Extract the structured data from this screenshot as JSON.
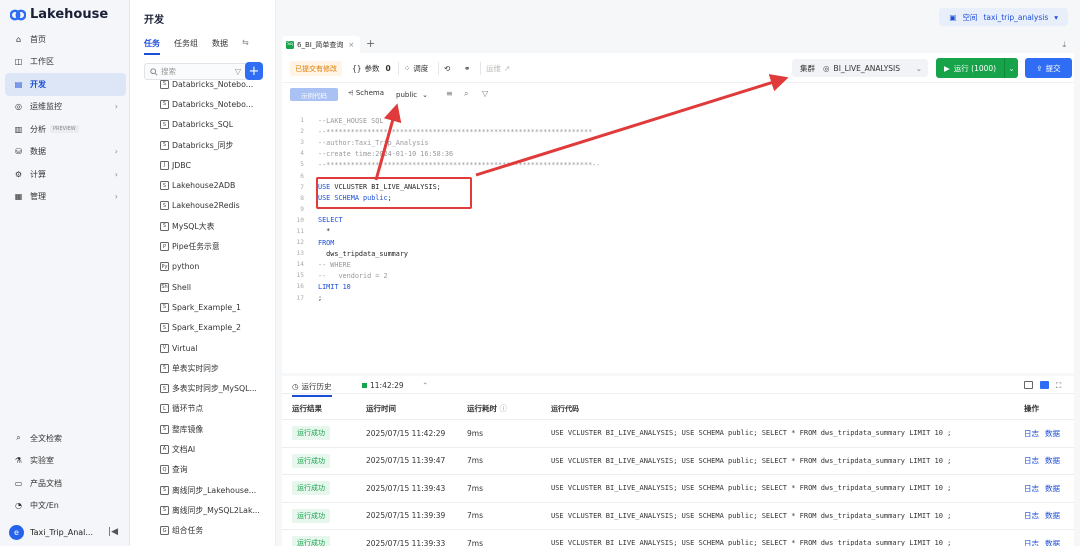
{
  "brand": {
    "name": "Lakehouse",
    "color": "#2f6df5"
  },
  "nav": {
    "items": [
      {
        "label": "首页",
        "icon": "home-icon"
      },
      {
        "label": "工作区",
        "icon": "cube-icon"
      },
      {
        "label": "开发",
        "icon": "code-icon",
        "active": true
      },
      {
        "label": "运维监控",
        "icon": "monitor-icon",
        "arrow": "›"
      },
      {
        "label": "分析",
        "icon": "chart-icon",
        "badge": "PREVIEW"
      },
      {
        "label": "数据",
        "icon": "database-icon",
        "arrow": "›"
      },
      {
        "label": "计算",
        "icon": "compute-icon",
        "arrow": "›"
      },
      {
        "label": "管理",
        "icon": "settings-icon",
        "arrow": "›"
      }
    ],
    "bottom": [
      {
        "label": "全文检索",
        "icon": "search-icon"
      },
      {
        "label": "实验室",
        "icon": "lab-icon"
      },
      {
        "label": "产品文档",
        "icon": "doc-icon"
      },
      {
        "label": "中文/En",
        "icon": "language-icon"
      }
    ],
    "user": {
      "name": "Taxi_Trip_Anal...",
      "initial": "e"
    }
  },
  "tasks_panel": {
    "title": "开发",
    "tabs": [
      "任务",
      "任务组",
      "数据"
    ],
    "search_placeholder": "搜索",
    "items": [
      {
        "label": "Databricks_Notebo...",
        "icon": "S"
      },
      {
        "label": "Databricks_Notebo...",
        "icon": "S"
      },
      {
        "label": "Databricks_SQL",
        "icon": "S"
      },
      {
        "label": "Databricks_同步",
        "icon": "S"
      },
      {
        "label": "JDBC",
        "icon": "J"
      },
      {
        "label": "Lakehouse2ADB",
        "icon": "S"
      },
      {
        "label": "Lakehouse2Redis",
        "icon": "S"
      },
      {
        "label": "MySQL大表",
        "icon": "S"
      },
      {
        "label": "Pipe任务示意",
        "icon": "P"
      },
      {
        "label": "python",
        "icon": "Py"
      },
      {
        "label": "Shell",
        "icon": "Sh"
      },
      {
        "label": "Spark_Example_1",
        "icon": "S"
      },
      {
        "label": "Spark_Example_2",
        "icon": "S"
      },
      {
        "label": "Virtual",
        "icon": "V"
      },
      {
        "label": "单表实时同步",
        "icon": "S"
      },
      {
        "label": "多表实时同步_MySQL...",
        "icon": "S"
      },
      {
        "label": "循环节点",
        "icon": "L"
      },
      {
        "label": "整库镜像",
        "icon": "S"
      },
      {
        "label": "文档AI",
        "icon": "A"
      },
      {
        "label": "查询",
        "icon": "Q"
      },
      {
        "label": "离线同步_Lakehouse...",
        "icon": "S"
      },
      {
        "label": "离线同步_MySQL2Lak...",
        "icon": "S"
      },
      {
        "label": "组合任务",
        "icon": "G"
      }
    ]
  },
  "header": {
    "space_label": "空间",
    "space_value": "taxi_trip_analysis"
  },
  "file_tab": {
    "label": "6_BI_简单查询",
    "icon": "Sq"
  },
  "toolbar": {
    "unsaved": "已提交有修改",
    "params": "参数",
    "params_count": "0",
    "schedule": "调度",
    "deploy": "运维",
    "cluster_label": "集群",
    "cluster_value": "BI_LIVE_ANALYSIS",
    "run_label": "运行 (1000)",
    "submit_label": "提交"
  },
  "subtoolbar": {
    "format": "示例代码",
    "schema_label": "Schema",
    "schema_value": "public"
  },
  "code_lines": [
    [
      {
        "t": "--LAKE_HOUSE SQL",
        "c": "cm"
      }
    ],
    [
      {
        "t": "--*****************************************************************",
        "c": "cm"
      }
    ],
    [
      {
        "t": "--author:Taxi_Trip_Analysis",
        "c": "cm"
      }
    ],
    [
      {
        "t": "--create time:2024-01-10 16:58:36",
        "c": "cm"
      }
    ],
    [
      {
        "t": "--*****************************************************************--",
        "c": "cm"
      }
    ],
    [],
    [
      {
        "t": "USE ",
        "c": "kw"
      },
      {
        "t": "VCLUSTER BI_LIVE_ANALYSIS;",
        "c": "tx"
      }
    ],
    [
      {
        "t": "USE ",
        "c": "kw"
      },
      {
        "t": "SCHEMA ",
        "c": "kw"
      },
      {
        "t": "public",
        "c": "kw"
      },
      {
        "t": ";",
        "c": "tx"
      }
    ],
    [],
    [
      {
        "t": "SELECT",
        "c": "kw"
      }
    ],
    [
      {
        "t": "  *",
        "c": "tx"
      }
    ],
    [
      {
        "t": "FROM",
        "c": "kw"
      }
    ],
    [
      {
        "t": "  dws_tripdata_summary",
        "c": "tx"
      }
    ],
    [
      {
        "t": "-- WHERE",
        "c": "cm"
      }
    ],
    [
      {
        "t": "--   vendorid = 2",
        "c": "cm"
      }
    ],
    [
      {
        "t": "LIMIT ",
        "c": "kw"
      },
      {
        "t": "10",
        "c": "kw"
      }
    ],
    [
      {
        "t": ";",
        "c": "tx"
      }
    ]
  ],
  "results": {
    "tab_history": "运行历史",
    "tab_run": "11:42:29",
    "headers": [
      "运行结果",
      "运行时间",
      "运行耗时",
      "运行代码",
      "操作"
    ],
    "actions": [
      "日志",
      "数据"
    ],
    "rows": [
      {
        "status": "运行成功",
        "time": "2025/07/15 11:42:29",
        "duration": "9ms",
        "code": "USE VCLUSTER BI_LIVE_ANALYSIS; USE SCHEMA public; SELECT * FROM dws_tripdata_summary LIMIT 10 ;"
      },
      {
        "status": "运行成功",
        "time": "2025/07/15 11:39:47",
        "duration": "7ms",
        "code": "USE VCLUSTER BI_LIVE_ANALYSIS; USE SCHEMA public; SELECT * FROM dws_tripdata_summary LIMIT 10 ;"
      },
      {
        "status": "运行成功",
        "time": "2025/07/15 11:39:43",
        "duration": "7ms",
        "code": "USE VCLUSTER BI_LIVE_ANALYSIS; USE SCHEMA public; SELECT * FROM dws_tripdata_summary LIMIT 10 ;"
      },
      {
        "status": "运行成功",
        "time": "2025/07/15 11:39:39",
        "duration": "7ms",
        "code": "USE VCLUSTER BI_LIVE_ANALYSIS; USE SCHEMA public; SELECT * FROM dws_tripdata_summary LIMIT 10 ;"
      },
      {
        "status": "运行成功",
        "time": "2025/07/15 11:39:33",
        "duration": "7ms",
        "code": "USE VCLUSTER BI_LIVE_ANALYSIS; USE SCHEMA public; SELECT * FROM dws_tripdata_summary LIMIT 10 ;"
      }
    ]
  },
  "colors": {
    "accent": "#2f6df5",
    "run": "#16a34a",
    "annotation": "#e03a3a"
  }
}
